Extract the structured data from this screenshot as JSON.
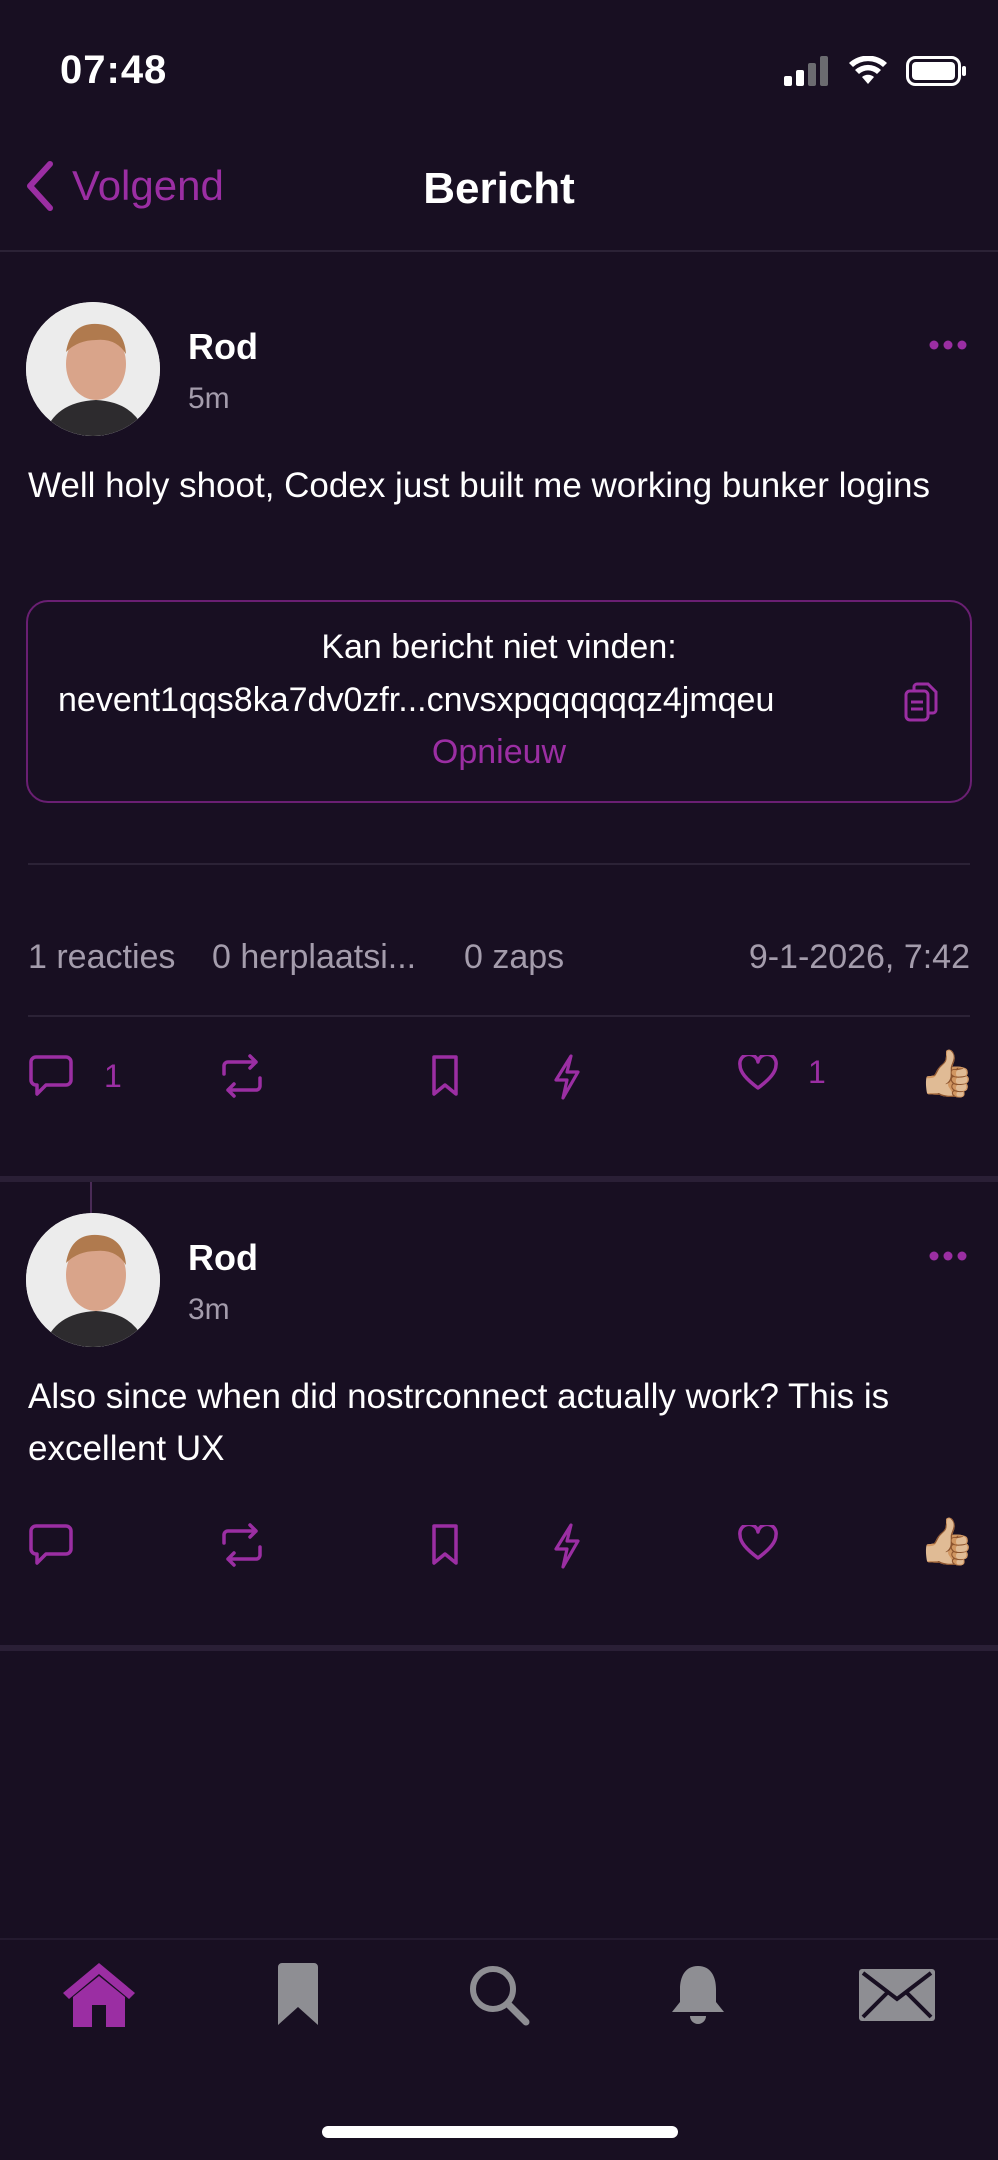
{
  "status_bar": {
    "time": "07:48"
  },
  "nav": {
    "back_label": "Volgend",
    "title": "Bericht"
  },
  "main_post": {
    "author": "Rod",
    "time": "5m",
    "content": "Well holy shoot, Codex just built me working bunker logins",
    "quote": {
      "error_text": "Kan bericht niet vinden:",
      "event_id": "nevent1qqs8ka7dv0zfr...cnvsxpqqqqqqz4jmqeu",
      "retry_label": "Opnieuw"
    },
    "stats": {
      "reactions": "1 reacties",
      "reposts": "0 herplaatsi...",
      "zaps": "0 zaps",
      "datetime": "9-1-2026, 7:42"
    },
    "actions": {
      "reply_count": "1",
      "like_count": "1",
      "reaction_emoji": "👍🏼"
    }
  },
  "reply_post": {
    "author": "Rod",
    "time": "3m",
    "content": "Also since when did nostrconnect actually work? This is excellent UX",
    "actions": {
      "reaction_emoji": "👍🏼"
    }
  },
  "tabbar": {
    "items": [
      "home-icon",
      "bookmark-icon",
      "search-icon",
      "bell-icon",
      "mail-icon"
    ],
    "active": "home-icon"
  },
  "colors": {
    "accent": "#9b2ea3",
    "background": "#180f22",
    "muted": "#a49cac",
    "inactive_icon": "#8e8e93"
  }
}
